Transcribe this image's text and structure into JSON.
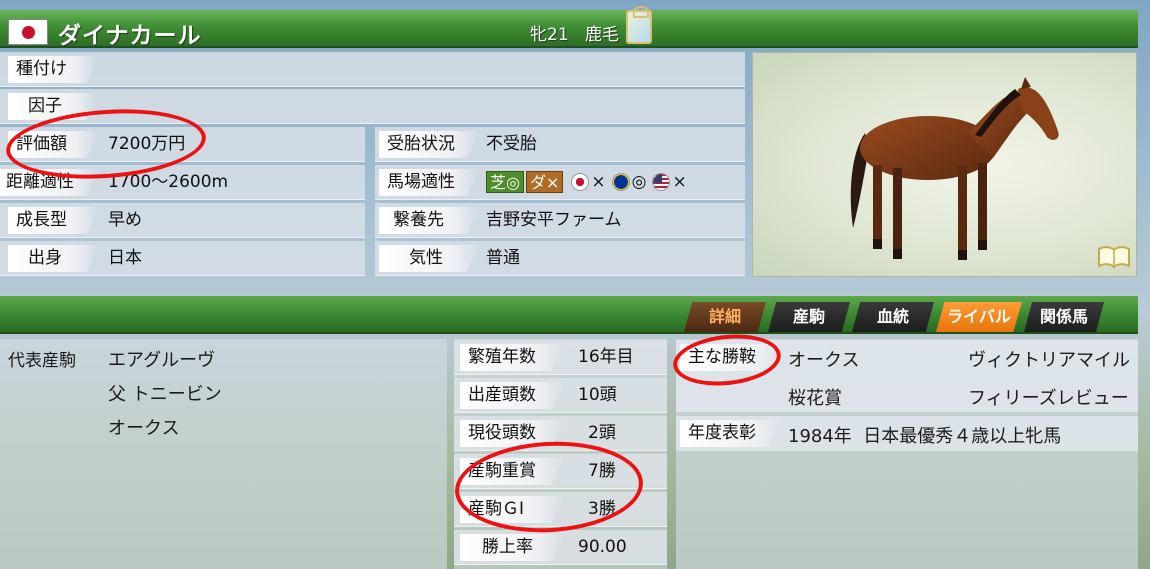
{
  "header": {
    "name": "ダイナカール",
    "sex_age": "牝21",
    "coat": "鹿毛"
  },
  "info_left": [
    {
      "label": "種付け",
      "value": ""
    },
    {
      "label": "因子",
      "value": ""
    },
    {
      "label": "評価額",
      "value": "7200万円"
    },
    {
      "label": "距離適性",
      "value": "1700〜2600m"
    },
    {
      "label": "成長型",
      "value": "早め"
    },
    {
      "label": "出身",
      "value": "日本"
    }
  ],
  "info_right": [
    {
      "label": "受胎状況",
      "value": "不受胎"
    },
    {
      "label": "馬場適性",
      "value": ""
    },
    {
      "label": "繋養先",
      "value": "吉野安平ファーム"
    },
    {
      "label": "気性",
      "value": "普通"
    }
  ],
  "surface": {
    "turf": "芝◎",
    "dirt": "ダ×",
    "jp": "×",
    "eu": "◎",
    "us": "×"
  },
  "tabs": [
    {
      "label": "詳細",
      "state": "active"
    },
    {
      "label": "産駒",
      "state": "normal"
    },
    {
      "label": "血統",
      "state": "normal"
    },
    {
      "label": "ライバル",
      "state": "highlight"
    },
    {
      "label": "関係馬",
      "state": "normal"
    }
  ],
  "representative": {
    "label": "代表産駒",
    "name": "エアグルーヴ",
    "sire": "父 トニービン",
    "race": "オークス"
  },
  "stats": [
    {
      "label": "繁殖年数",
      "value": "16年目"
    },
    {
      "label": "出産頭数",
      "value": "10頭"
    },
    {
      "label": "現役頭数",
      "value": "2頭"
    },
    {
      "label": "産駒重賞",
      "value": "7勝"
    },
    {
      "label": "産駒ＧⅠ",
      "value": "3勝"
    },
    {
      "label": "勝上率",
      "value": "90.00"
    }
  ],
  "major_wins": {
    "label": "主な勝鞍",
    "wins": [
      "オークス",
      "ヴィクトリアマイル",
      "桜花賞",
      "フィリーズレビュー"
    ]
  },
  "annual_award": {
    "label": "年度表彰",
    "value": "1984年  日本最優秀４歳以上牝馬"
  },
  "colors": {
    "header_green": "#3f8e34",
    "annotation_red": "#e11111",
    "active_tab_text": "#ffb35a"
  }
}
